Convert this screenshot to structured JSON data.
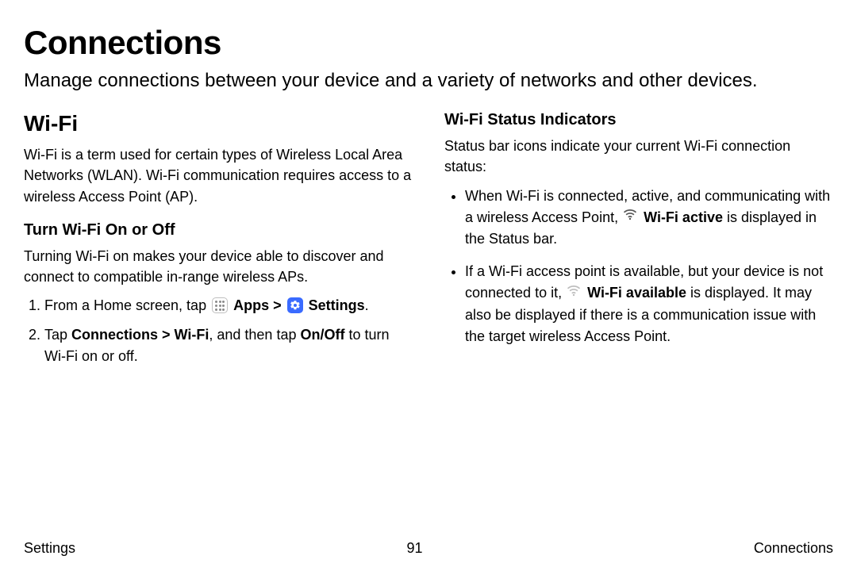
{
  "title": "Connections",
  "intro": "Manage connections between your device and a variety of networks and other devices.",
  "left": {
    "heading": "Wi-Fi",
    "desc": "Wi-Fi is a term used for certain types of Wireless Local Area Networks (WLAN). Wi-Fi communication requires access to a wireless Access Point (AP).",
    "sub1": "Turn Wi-Fi On or Off",
    "sub1_desc": "Turning Wi-Fi on makes your device able to discover and connect to compatible in-range wireless APs.",
    "step1_prefix": "From a Home screen, tap ",
    "step1_apps": "Apps",
    "step1_sep": " > ",
    "step1_settings": "Settings",
    "step1_suffix": ".",
    "step2_prefix": "Tap ",
    "step2_path": "Connections > Wi-Fi",
    "step2_mid": ", and then tap ",
    "step2_onoff": "On/Off",
    "step2_suffix": " to turn Wi-Fi on or off."
  },
  "right": {
    "heading": "Wi-Fi Status Indicators",
    "desc": "Status bar icons indicate your current Wi-Fi connection status:",
    "b1_prefix": "When Wi-Fi is connected, active, and communicating with a wireless Access Point, ",
    "b1_bold": "Wi-Fi active",
    "b1_suffix": " is displayed in the Status bar.",
    "b2_prefix": "If a Wi-Fi access point is available, but your device is not connected to it, ",
    "b2_bold": "Wi-Fi available",
    "b2_suffix": " is displayed. It may also be displayed if there is a communication issue with the target wireless Access Point."
  },
  "footer": {
    "left": "Settings",
    "center": "91",
    "right": "Connections"
  }
}
